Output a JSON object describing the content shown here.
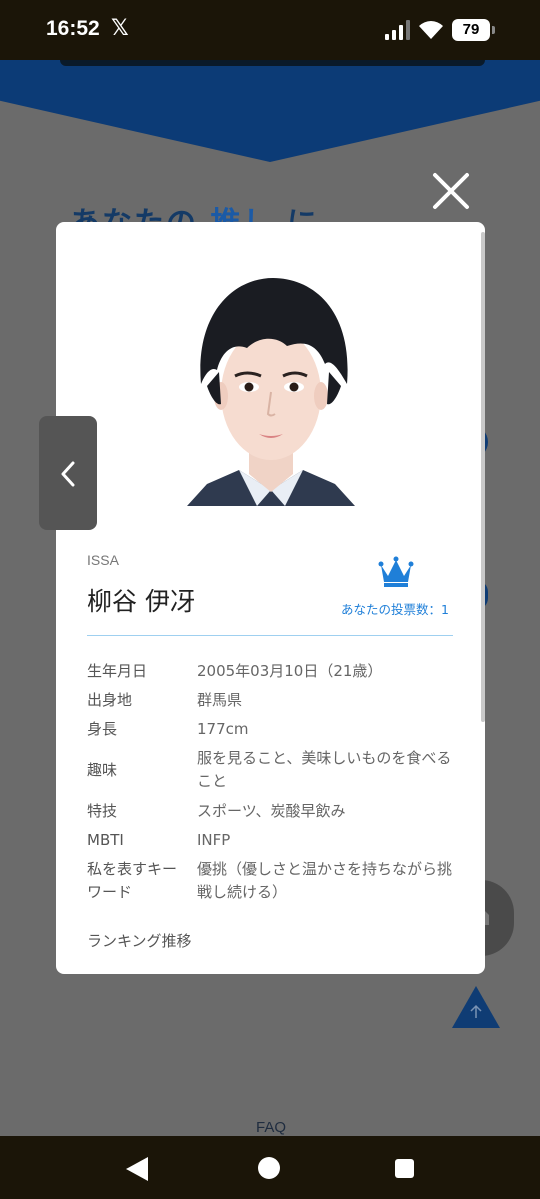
{
  "status_bar": {
    "time": "16:52",
    "app_icon": "𝕏",
    "battery": "79"
  },
  "background": {
    "heading_prefix": "あなたの",
    "heading_accent": "推し",
    "heading_suffix": "に",
    "faq_label": "FAQ",
    "banner_color": "#0c3b76"
  },
  "modal": {
    "name_en": "ISSA",
    "name_ja": "柳谷 伊冴",
    "vote_label": "あなたの投票数：1",
    "accent_color": "#1f7fd8",
    "profile": [
      {
        "label": "生年月日",
        "value": "2005年03月10日（21歳）"
      },
      {
        "label": "出身地",
        "value": "群馬県"
      },
      {
        "label": "身長",
        "value": "177cm"
      },
      {
        "label": "趣味",
        "value": "服を見ること、美味しいものを食べること"
      },
      {
        "label": "特技",
        "value": "スポーツ、炭酸早飲み"
      },
      {
        "label": "MBTI",
        "value": "INFP"
      },
      {
        "label": "私を表すキーワード",
        "value": "優挑（優しさと温かさを持ちながら挑戦し続ける）"
      }
    ],
    "ranking_label": "ランキング推移"
  },
  "icons": {
    "close": "close-icon",
    "prev": "chevron-left-icon",
    "crown": "crown-icon",
    "home": "home-icon",
    "scroll_top": "arrow-up-icon"
  }
}
